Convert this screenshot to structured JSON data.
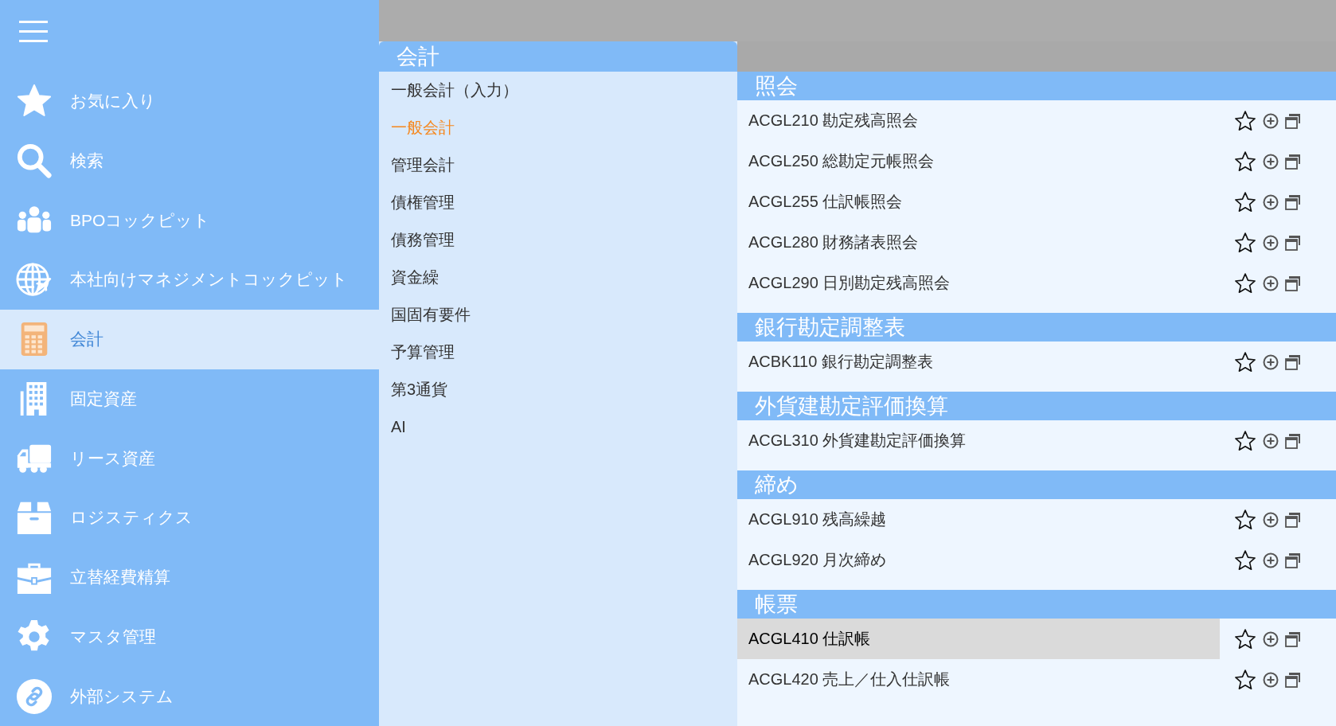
{
  "sidebar": {
    "items": [
      {
        "label": "お気に入り",
        "selected": false
      },
      {
        "label": "検索",
        "selected": false
      },
      {
        "label": "BPOコックピット",
        "selected": false
      },
      {
        "label": "本社向けマネジメントコックピット",
        "selected": false
      },
      {
        "label": "会計",
        "selected": true
      },
      {
        "label": "固定資産",
        "selected": false
      },
      {
        "label": "リース資産",
        "selected": false
      },
      {
        "label": "ロジスティクス",
        "selected": false
      },
      {
        "label": "立替経費精算",
        "selected": false
      },
      {
        "label": "マスタ管理",
        "selected": false
      },
      {
        "label": "外部システム",
        "selected": false
      }
    ]
  },
  "category_panel": {
    "title": "会計",
    "items": [
      {
        "label": "一般会計（入力）",
        "selected": false
      },
      {
        "label": "一般会計",
        "selected": true
      },
      {
        "label": "管理会計",
        "selected": false
      },
      {
        "label": "債権管理",
        "selected": false
      },
      {
        "label": "債務管理",
        "selected": false
      },
      {
        "label": "資金繰",
        "selected": false
      },
      {
        "label": "国固有要件",
        "selected": false
      },
      {
        "label": "予算管理",
        "selected": false
      },
      {
        "label": "第3通貨",
        "selected": false
      },
      {
        "label": "AI",
        "selected": false
      }
    ]
  },
  "function_panel": {
    "sections": [
      {
        "title": "照会",
        "rows": [
          {
            "label": "ACGL210 勘定残高照会",
            "highlighted": false
          },
          {
            "label": "ACGL250 総勘定元帳照会",
            "highlighted": false
          },
          {
            "label": "ACGL255 仕訳帳照会",
            "highlighted": false
          },
          {
            "label": "ACGL280 財務諸表照会",
            "highlighted": false
          },
          {
            "label": "ACGL290 日別勘定残高照会",
            "highlighted": false
          }
        ]
      },
      {
        "title": "銀行勘定調整表",
        "rows": [
          {
            "label": "ACBK110 銀行勘定調整表",
            "highlighted": false
          }
        ]
      },
      {
        "title": "外貨建勘定評価換算",
        "rows": [
          {
            "label": "ACGL310 外貨建勘定評価換算",
            "highlighted": false
          }
        ]
      },
      {
        "title": "締め",
        "rows": [
          {
            "label": "ACGL910 残高繰越",
            "highlighted": false
          },
          {
            "label": "ACGL920 月次締め",
            "highlighted": false
          }
        ]
      },
      {
        "title": "帳票",
        "rows": [
          {
            "label": "ACGL410 仕訳帳",
            "highlighted": true
          },
          {
            "label": "ACGL420 売上／仕入仕訳帳",
            "highlighted": false
          }
        ]
      }
    ]
  }
}
